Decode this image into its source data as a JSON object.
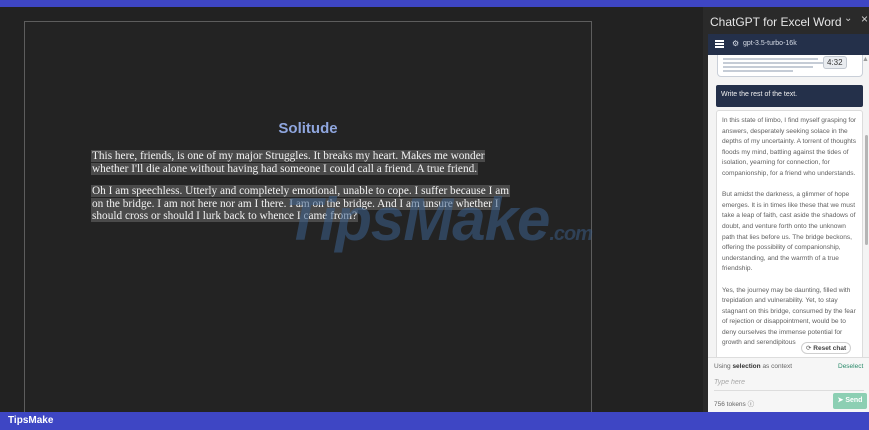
{
  "document": {
    "title": "Solitude",
    "para1_lines": [
      "This here, friends, is one of my major Struggles. It breaks my heart. Makes me wonder",
      "whether I'll die alone without having had someone I could call a friend. A true friend."
    ],
    "para2_lines": [
      "Oh I am speechless. Utterly and completely emotional, unable to cope. I suffer because I am",
      "on the bridge. I am not here nor am I there. I am on the bridge. And I am unsure whether I",
      "should cross or should I lurk back to whence I came from?"
    ]
  },
  "watermark": {
    "text": "TipsMake",
    "suffix": ".com"
  },
  "panel": {
    "title": "ChatGPT for Excel Word",
    "chevron_icon": "chevron-down-icon",
    "close_icon": "close-icon",
    "model": "gpt-3.5-turbo-16k",
    "time_badge": "4:32",
    "prompt": "Write the rest of the text.",
    "response_paragraphs": [
      "In this state of limbo, I find myself grasping for answers, desperately seeking solace in the depths of my uncertainty. A torrent of thoughts floods my mind, battling against the tides of isolation, yearning for connection, for companionship, for a friend who understands.",
      "But amidst the darkness, a glimmer of hope emerges. It is in times like these that we must take a leap of faith, cast aside the shadows of doubt, and venture forth onto the unknown path that lies before us. The bridge beckons, offering the possibility of companionship, understanding, and the warmth of a true friendship.",
      "Yes, the journey may be daunting, filled with trepidation and vulnerability. Yet, to stay stagnant on this bridge, consumed by the fear of rejection or disappointment, would be to deny ourselves the immense potential for growth and serendipitous"
    ],
    "reset_chat": "Reset chat",
    "context_prefix": "Using",
    "context_bold": "selection",
    "context_suffix": "as context",
    "deselect": "Deselect",
    "input_placeholder": "Type here",
    "tokens": "756 tokens",
    "send": "Send"
  },
  "status_bar": {
    "brand": "TipsMake"
  },
  "colors": {
    "accent_bar": "#3e46c4",
    "title_blue": "#8fa6de",
    "panel_header": "#24304a",
    "send_green": "#8ccfb3"
  }
}
